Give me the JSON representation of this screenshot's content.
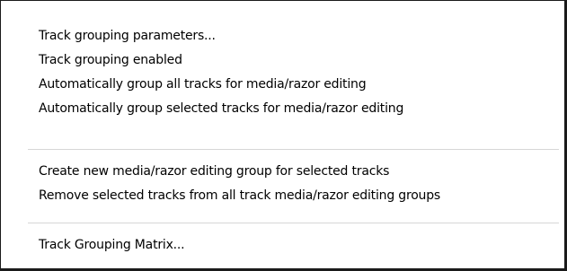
{
  "menu": {
    "groups": [
      {
        "items": [
          {
            "label": "Track grouping parameters..."
          },
          {
            "label": "Track grouping enabled"
          },
          {
            "label": "Automatically group all tracks for media/razor editing"
          },
          {
            "label": "Automatically group selected tracks for media/razor editing"
          }
        ]
      },
      {
        "items": [
          {
            "label": "Create new media/razor editing group for selected tracks"
          },
          {
            "label": "Remove selected tracks from all track media/razor editing groups"
          }
        ]
      },
      {
        "items": [
          {
            "label": "Track Grouping Matrix..."
          }
        ]
      }
    ]
  }
}
